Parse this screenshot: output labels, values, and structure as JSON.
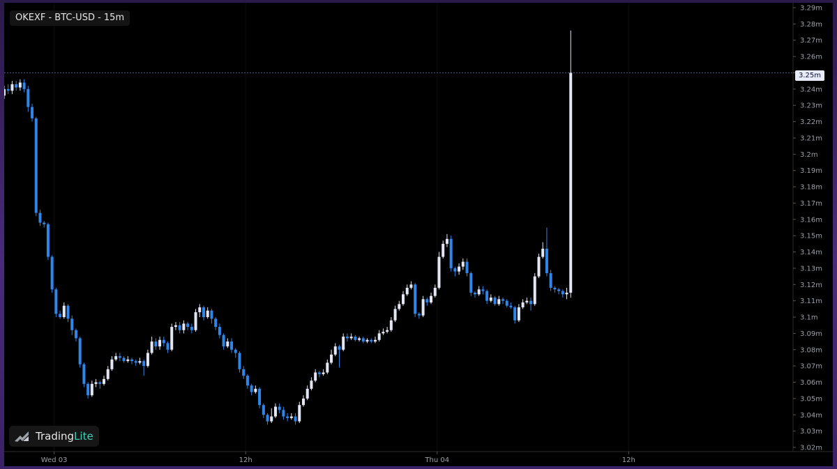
{
  "title": "OKEXF - BTC-USD - 15m",
  "logo": {
    "name_part1": "Trading",
    "name_part2": "Lite",
    "icon": "tradinglite-logo-icon"
  },
  "colors": {
    "background": "#000000",
    "up": "#e3e6f5",
    "down": "#2f86e8",
    "axis_text": "#9aa0a6",
    "price_line": "#4a5a8a"
  },
  "current_price_label": "3.25m",
  "chart_data": {
    "type": "candlestick",
    "ylim": [
      3.02,
      3.29
    ],
    "y_ticks": [
      "3.29m",
      "3.28m",
      "3.27m",
      "3.26m",
      "3.25m",
      "3.24m",
      "3.23m",
      "3.22m",
      "3.21m",
      "3.2m",
      "3.19m",
      "3.18m",
      "3.17m",
      "3.16m",
      "3.15m",
      "3.14m",
      "3.13m",
      "3.12m",
      "3.11m",
      "3.1m",
      "3.09m",
      "3.08m",
      "3.07m",
      "3.06m",
      "3.05m",
      "3.04m",
      "3.03m",
      "3.02m"
    ],
    "x_ticks": [
      {
        "label": "Wed 03",
        "index": 12
      },
      {
        "label": "12h",
        "index": 60
      },
      {
        "label": "Thu 04",
        "index": 108
      },
      {
        "label": "12h",
        "index": 156
      }
    ],
    "current_price": 3.25,
    "candles": [
      [
        3.236,
        3.24,
        3.242,
        3.234
      ],
      [
        3.24,
        3.239,
        3.243,
        3.237
      ],
      [
        3.239,
        3.243,
        3.245,
        3.237
      ],
      [
        3.243,
        3.241,
        3.245,
        3.239
      ],
      [
        3.241,
        3.244,
        3.246,
        3.239
      ],
      [
        3.244,
        3.24,
        3.246,
        3.238
      ],
      [
        3.24,
        3.229,
        3.242,
        3.226
      ],
      [
        3.229,
        3.222,
        3.231,
        3.22
      ],
      [
        3.222,
        3.164,
        3.223,
        3.162
      ],
      [
        3.164,
        3.158,
        3.166,
        3.156
      ],
      [
        3.158,
        3.157,
        3.159,
        3.155
      ],
      [
        3.157,
        3.137,
        3.158,
        3.135
      ],
      [
        3.137,
        3.117,
        3.138,
        3.115
      ],
      [
        3.117,
        3.102,
        3.118,
        3.1
      ],
      [
        3.102,
        3.1,
        3.104,
        3.099
      ],
      [
        3.1,
        3.107,
        3.109,
        3.099
      ],
      [
        3.107,
        3.099,
        3.108,
        3.097
      ],
      [
        3.099,
        3.092,
        3.101,
        3.089
      ],
      [
        3.092,
        3.087,
        3.093,
        3.085
      ],
      [
        3.087,
        3.071,
        3.088,
        3.069
      ],
      [
        3.071,
        3.059,
        3.072,
        3.057
      ],
      [
        3.059,
        3.052,
        3.06,
        3.05
      ],
      [
        3.052,
        3.059,
        3.061,
        3.051
      ],
      [
        3.059,
        3.06,
        3.062,
        3.057
      ],
      [
        3.06,
        3.059,
        3.061,
        3.056
      ],
      [
        3.059,
        3.062,
        3.064,
        3.058
      ],
      [
        3.062,
        3.068,
        3.07,
        3.061
      ],
      [
        3.068,
        3.074,
        3.076,
        3.067
      ],
      [
        3.074,
        3.076,
        3.078,
        3.073
      ],
      [
        3.076,
        3.075,
        3.078,
        3.073
      ],
      [
        3.075,
        3.073,
        3.076,
        3.072
      ],
      [
        3.073,
        3.074,
        3.076,
        3.072
      ],
      [
        3.074,
        3.073,
        3.075,
        3.071
      ],
      [
        3.073,
        3.072,
        3.074,
        3.07
      ],
      [
        3.072,
        3.073,
        3.075,
        3.071
      ],
      [
        3.073,
        3.07,
        3.074,
        3.064
      ],
      [
        3.07,
        3.078,
        3.08,
        3.069
      ],
      [
        3.078,
        3.085,
        3.088,
        3.077
      ],
      [
        3.085,
        3.082,
        3.087,
        3.08
      ],
      [
        3.082,
        3.086,
        3.088,
        3.08
      ],
      [
        3.086,
        3.084,
        3.088,
        3.082
      ],
      [
        3.084,
        3.08,
        3.085,
        3.078
      ],
      [
        3.08,
        3.094,
        3.096,
        3.079
      ],
      [
        3.094,
        3.095,
        3.097,
        3.092
      ],
      [
        3.095,
        3.092,
        3.097,
        3.09
      ],
      [
        3.092,
        3.096,
        3.098,
        3.09
      ],
      [
        3.096,
        3.094,
        3.097,
        3.092
      ],
      [
        3.094,
        3.092,
        3.096,
        3.09
      ],
      [
        3.092,
        3.103,
        3.105,
        3.091
      ],
      [
        3.103,
        3.106,
        3.108,
        3.1
      ],
      [
        3.106,
        3.1,
        3.107,
        3.098
      ],
      [
        3.1,
        3.104,
        3.106,
        3.099
      ],
      [
        3.104,
        3.099,
        3.105,
        3.096
      ],
      [
        3.099,
        3.094,
        3.1,
        3.092
      ],
      [
        3.094,
        3.089,
        3.096,
        3.087
      ],
      [
        3.089,
        3.082,
        3.09,
        3.08
      ],
      [
        3.082,
        3.085,
        3.087,
        3.081
      ],
      [
        3.085,
        3.08,
        3.087,
        3.078
      ],
      [
        3.08,
        3.078,
        3.081,
        3.075
      ],
      [
        3.078,
        3.068,
        3.079,
        3.066
      ],
      [
        3.068,
        3.064,
        3.07,
        3.062
      ],
      [
        3.064,
        3.058,
        3.065,
        3.056
      ],
      [
        3.058,
        3.054,
        3.059,
        3.052
      ],
      [
        3.054,
        3.056,
        3.058,
        3.053
      ],
      [
        3.056,
        3.046,
        3.057,
        3.044
      ],
      [
        3.046,
        3.04,
        3.047,
        3.038
      ],
      [
        3.04,
        3.036,
        3.041,
        3.034
      ],
      [
        3.036,
        3.039,
        3.044,
        3.035
      ],
      [
        3.039,
        3.045,
        3.047,
        3.038
      ],
      [
        3.045,
        3.043,
        3.047,
        3.041
      ],
      [
        3.043,
        3.039,
        3.045,
        3.037
      ],
      [
        3.039,
        3.038,
        3.041,
        3.036
      ],
      [
        3.038,
        3.039,
        3.041,
        3.037
      ],
      [
        3.039,
        3.036,
        3.041,
        3.034
      ],
      [
        3.036,
        3.046,
        3.048,
        3.035
      ],
      [
        3.046,
        3.05,
        3.052,
        3.045
      ],
      [
        3.05,
        3.056,
        3.058,
        3.049
      ],
      [
        3.056,
        3.061,
        3.063,
        3.055
      ],
      [
        3.061,
        3.066,
        3.068,
        3.06
      ],
      [
        3.066,
        3.065,
        3.067,
        3.063
      ],
      [
        3.065,
        3.066,
        3.068,
        3.064
      ],
      [
        3.066,
        3.072,
        3.074,
        3.065
      ],
      [
        3.072,
        3.077,
        3.08,
        3.071
      ],
      [
        3.077,
        3.082,
        3.084,
        3.076
      ],
      [
        3.082,
        3.08,
        3.083,
        3.069
      ],
      [
        3.08,
        3.088,
        3.09,
        3.079
      ],
      [
        3.088,
        3.087,
        3.09,
        3.085
      ],
      [
        3.087,
        3.088,
        3.09,
        3.086
      ],
      [
        3.088,
        3.086,
        3.089,
        3.085
      ],
      [
        3.086,
        3.087,
        3.088,
        3.085
      ],
      [
        3.087,
        3.085,
        3.088,
        3.084
      ],
      [
        3.085,
        3.086,
        3.087,
        3.084
      ],
      [
        3.086,
        3.085,
        3.087,
        3.084
      ],
      [
        3.085,
        3.086,
        3.088,
        3.084
      ],
      [
        3.086,
        3.09,
        3.092,
        3.085
      ],
      [
        3.09,
        3.091,
        3.093,
        3.089
      ],
      [
        3.091,
        3.092,
        3.094,
        3.09
      ],
      [
        3.092,
        3.098,
        3.1,
        3.091
      ],
      [
        3.098,
        3.105,
        3.107,
        3.097
      ],
      [
        3.105,
        3.108,
        3.11,
        3.104
      ],
      [
        3.108,
        3.114,
        3.116,
        3.107
      ],
      [
        3.114,
        3.118,
        3.12,
        3.113
      ],
      [
        3.118,
        3.12,
        3.122,
        3.117
      ],
      [
        3.12,
        3.102,
        3.121,
        3.1
      ],
      [
        3.102,
        3.101,
        3.103,
        3.099
      ],
      [
        3.101,
        3.111,
        3.113,
        3.1
      ],
      [
        3.111,
        3.109,
        3.112,
        3.107
      ],
      [
        3.109,
        3.113,
        3.115,
        3.108
      ],
      [
        3.113,
        3.118,
        3.12,
        3.112
      ],
      [
        3.118,
        3.137,
        3.14,
        3.117
      ],
      [
        3.137,
        3.145,
        3.147,
        3.136
      ],
      [
        3.145,
        3.148,
        3.151,
        3.143
      ],
      [
        3.148,
        3.13,
        3.15,
        3.128
      ],
      [
        3.13,
        3.128,
        3.131,
        3.125
      ],
      [
        3.128,
        3.131,
        3.133,
        3.126
      ],
      [
        3.131,
        3.134,
        3.136,
        3.129
      ],
      [
        3.134,
        3.127,
        3.136,
        3.125
      ],
      [
        3.127,
        3.115,
        3.128,
        3.113
      ],
      [
        3.115,
        3.114,
        3.116,
        3.112
      ],
      [
        3.114,
        3.117,
        3.119,
        3.113
      ],
      [
        3.117,
        3.116,
        3.119,
        3.114
      ],
      [
        3.116,
        3.11,
        3.117,
        3.108
      ],
      [
        3.11,
        3.112,
        3.114,
        3.109
      ],
      [
        3.112,
        3.108,
        3.113,
        3.107
      ],
      [
        3.108,
        3.111,
        3.113,
        3.107
      ],
      [
        3.111,
        3.11,
        3.112,
        3.108
      ],
      [
        3.11,
        3.107,
        3.111,
        3.106
      ],
      [
        3.107,
        3.106,
        3.109,
        3.105
      ],
      [
        3.106,
        3.098,
        3.107,
        3.096
      ],
      [
        3.098,
        3.106,
        3.108,
        3.097
      ],
      [
        3.106,
        3.109,
        3.111,
        3.105
      ],
      [
        3.109,
        3.11,
        3.112,
        3.108
      ],
      [
        3.11,
        3.108,
        3.112,
        3.104
      ],
      [
        3.108,
        3.125,
        3.127,
        3.107
      ],
      [
        3.125,
        3.137,
        3.139,
        3.124
      ],
      [
        3.137,
        3.142,
        3.146,
        3.136
      ],
      [
        3.142,
        3.127,
        3.155,
        3.125
      ],
      [
        3.127,
        3.118,
        3.129,
        3.116
      ],
      [
        3.118,
        3.117,
        3.119,
        3.115
      ],
      [
        3.117,
        3.116,
        3.118,
        3.114
      ],
      [
        3.116,
        3.114,
        3.117,
        3.112
      ],
      [
        3.114,
        3.115,
        3.118,
        3.111
      ],
      [
        3.115,
        3.25,
        3.276,
        3.112
      ]
    ]
  }
}
